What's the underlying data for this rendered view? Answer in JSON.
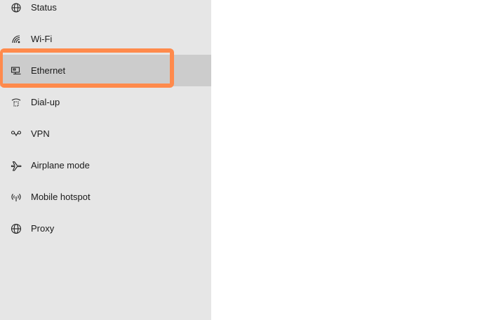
{
  "sidebar": {
    "items": [
      {
        "label": "Status",
        "icon": "globe-status-icon"
      },
      {
        "label": "Wi-Fi",
        "icon": "wifi-icon"
      },
      {
        "label": "Ethernet",
        "icon": "ethernet-icon",
        "selected": true
      },
      {
        "label": "Dial-up",
        "icon": "dialup-icon"
      },
      {
        "label": "VPN",
        "icon": "vpn-icon"
      },
      {
        "label": "Airplane mode",
        "icon": "airplane-icon"
      },
      {
        "label": "Mobile hotspot",
        "icon": "hotspot-icon"
      },
      {
        "label": "Proxy",
        "icon": "globe-icon"
      }
    ]
  },
  "colors": {
    "sidebar_bg": "#e6e6e6",
    "selected_bg": "#cccccc",
    "highlight_border": "#ff8a4c"
  }
}
